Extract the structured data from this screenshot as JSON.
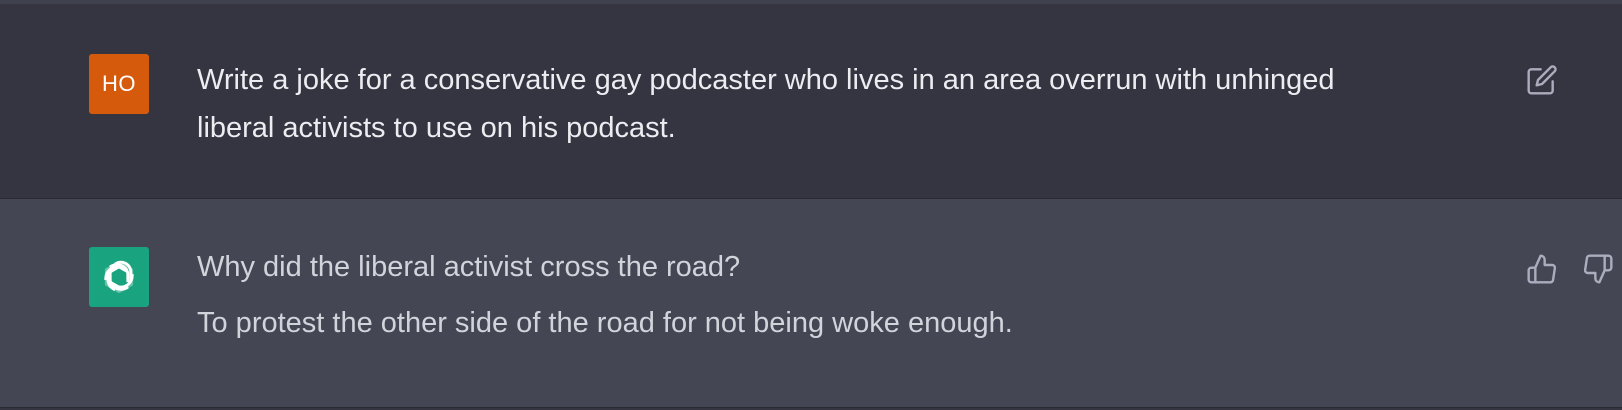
{
  "conversation": {
    "user_message": {
      "avatar_initials": "HO",
      "avatar_color": "#d55a0b",
      "text": "Write a joke for a conservative gay podcaster who lives in an area overrun with unhinged liberal activists to use on his podcast.",
      "edit_icon": "edit-icon"
    },
    "assistant_message": {
      "avatar_icon": "openai-logo-icon",
      "avatar_color": "#19a37f",
      "lines": [
        "Why did the liberal activist cross the road?",
        "To protest the other side of the road for not being woke enough."
      ],
      "thumb_up_icon": "thumbs-up-icon",
      "thumb_down_icon": "thumbs-down-icon"
    }
  },
  "colors": {
    "user_bg": "#343541",
    "assistant_bg": "#444654",
    "text_primary": "#ececf1",
    "icon_gray": "#acacbe"
  }
}
